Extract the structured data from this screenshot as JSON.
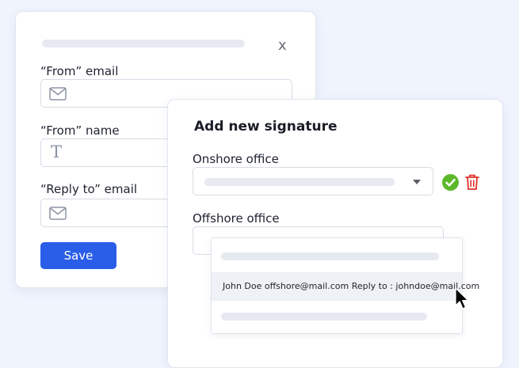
{
  "back_form": {
    "close_label": "x",
    "from_email_label": "“From” email",
    "from_name_label": "“From” name",
    "reply_to_label": "“Reply to” email",
    "save_label": "Save"
  },
  "signature_panel": {
    "title": "Add new signature",
    "onshore_label": "Onshore office",
    "offshore_label": "Offshore office"
  },
  "dropdown": {
    "selected_option": "John Doe offshore@mail.com Reply to : johndoe@mail.com"
  },
  "colors": {
    "accent": "#2a5ee8",
    "success": "#5cb82a",
    "danger": "#e0302a",
    "background": "#f0f4fd"
  },
  "icons": [
    "envelope-icon",
    "text-t-icon",
    "chevron-down-icon",
    "check-circle-icon",
    "trash-icon",
    "mouse-cursor-icon"
  ]
}
